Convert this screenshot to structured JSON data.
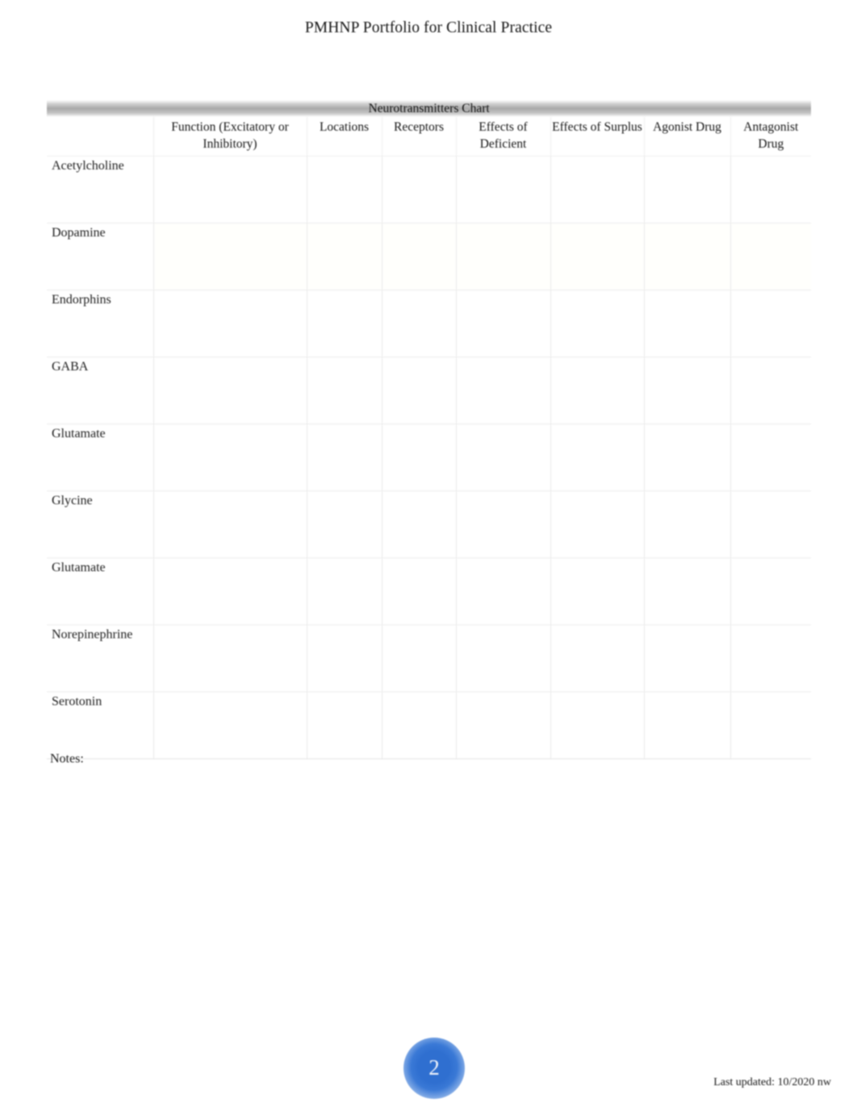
{
  "document": {
    "title": "PMHNP Portfolio for Clinical Practice",
    "notes_label": "Notes:",
    "page_number": "2",
    "footer": "Last updated: 10/2020 nw"
  },
  "table": {
    "banner_title": "Neurotransmitters Chart",
    "row_label_header": "",
    "columns": [
      "Function (Excitatory or Inhibitory)",
      "Locations",
      "Receptors",
      "Effects of Deficient",
      "Effects of Surplus",
      "Agonist Drug",
      "Antagonist Drug"
    ],
    "rows": [
      {
        "label": "Acetylcholine",
        "cells": [
          "",
          "",
          "",
          "",
          "",
          "",
          ""
        ]
      },
      {
        "label": "Dopamine",
        "cells": [
          "",
          "",
          "",
          "",
          "",
          "",
          ""
        ]
      },
      {
        "label": "Endorphins",
        "cells": [
          "",
          "",
          "",
          "",
          "",
          "",
          ""
        ]
      },
      {
        "label": "GABA",
        "cells": [
          "",
          "",
          "",
          "",
          "",
          "",
          ""
        ]
      },
      {
        "label": "Glutamate",
        "cells": [
          "",
          "",
          "",
          "",
          "",
          "",
          ""
        ]
      },
      {
        "label": "Glycine",
        "cells": [
          "",
          "",
          "",
          "",
          "",
          "",
          ""
        ]
      },
      {
        "label": "Glutamate",
        "cells": [
          "",
          "",
          "",
          "",
          "",
          "",
          ""
        ]
      },
      {
        "label": "Norepinephrine",
        "cells": [
          "",
          "",
          "",
          "",
          "",
          "",
          ""
        ]
      },
      {
        "label": "Serotonin",
        "cells": [
          "",
          "",
          "",
          "",
          "",
          "",
          ""
        ]
      }
    ]
  },
  "colors": {
    "banner_gray": "#a8a8a8",
    "page_badge_blue": "#2f6fd0",
    "grid_line": "#ededed",
    "text": "#1a1a1a"
  }
}
